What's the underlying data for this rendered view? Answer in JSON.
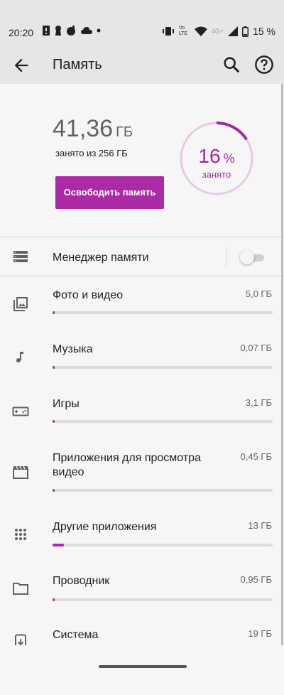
{
  "status_bar": {
    "time": "20:20",
    "battery": "15 %",
    "network_label": "4G+",
    "volte_label": "Vo LTE",
    "icons": [
      "alert-icon",
      "keyhole-icon",
      "bomb-icon",
      "cloud-icon",
      "dot-icon",
      "vibrate-icon",
      "wifi-icon",
      "signal-icon",
      "battery-icon"
    ]
  },
  "app_bar": {
    "title": "Память",
    "icons": [
      "back-arrow-icon",
      "search-icon",
      "help-icon"
    ]
  },
  "summary": {
    "used_value": "41,36",
    "used_unit": "ГБ",
    "used_of": "занято из 256 ГБ",
    "free_button": "Освободить память",
    "percent": "16",
    "percent_sign": "%",
    "percent_label": "занято",
    "percent_fraction": 0.16
  },
  "storage_manager": {
    "label": "Менеджер памяти",
    "enabled": false,
    "icon": "storage-list-icon"
  },
  "categories": [
    {
      "label": "Фото и видео",
      "size": "5,0 ГБ",
      "icon": "photo-icon",
      "fraction": 0.01
    },
    {
      "label": "Музыка",
      "size": "0,07 ГБ",
      "icon": "music-note-icon",
      "fraction": 0.0
    },
    {
      "label": "Игры",
      "size": "3,1 ГБ",
      "icon": "gamepad-icon",
      "fraction": 0.01
    },
    {
      "label": "Приложения для просмотра видео",
      "size": "0,45 ГБ",
      "icon": "clapperboard-icon",
      "fraction": 0.0
    },
    {
      "label": "Другие приложения",
      "size": "13 ГБ",
      "icon": "apps-grid-icon",
      "fraction": 0.05
    },
    {
      "label": "Проводник",
      "size": "0,95 ГБ",
      "icon": "folder-icon",
      "fraction": 0.0
    },
    {
      "label": "Система",
      "size": "19 ГБ",
      "icon": "system-update-icon",
      "fraction": 0.07
    }
  ],
  "colors": {
    "accent": "#ad2aa6",
    "ring_track": "#e8c9e6",
    "bar_track": "#dcdcdc",
    "bar_background": "#e6e6e6"
  }
}
